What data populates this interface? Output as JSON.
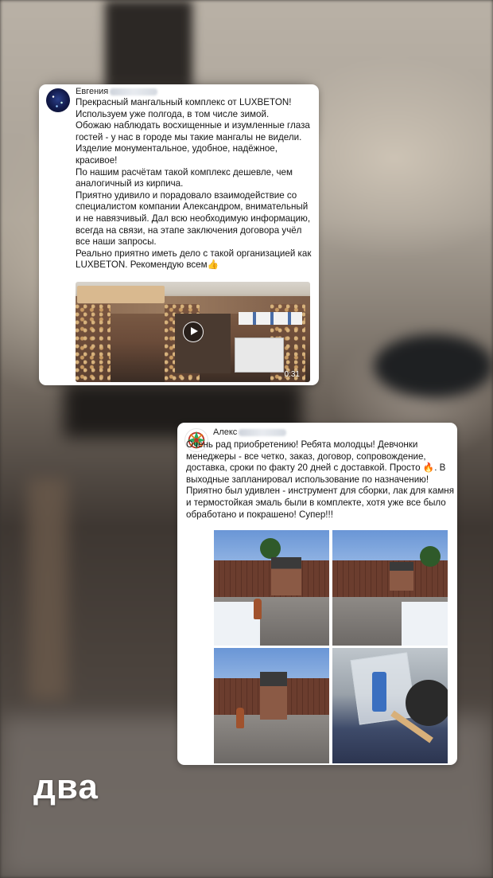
{
  "review1": {
    "author": "Евгения",
    "text": "Прекрасный мангальный комплекс от LUXBETON!\nИспользуем уже полгода, в том числе зимой.\nОбожаю наблюдать восхищенные и изумленные глаза гостей - у нас в городе мы такие мангалы не видели.\nИзделие монументальное, удобное, надёжное, красивое!\nПо нашим расчётам такой комплекс  дешевле, чем аналогичный из кирпича.\nПриятно удивило и порадовало взаимодействие со специалистом компании Александром, внимательный и не навязчивый. Дал всю необходимую информацию, всегда на связи, на этапе заключения договора учёл все наши запросы.\nРеально приятно иметь дело с такой организацией как LUXBETON. Рекомендую всем👍",
    "video": {
      "duration": "0:31",
      "icon": "play-icon"
    }
  },
  "review2": {
    "author": "Алекс",
    "text": "Очень рад приобретению! Ребята молодцы! Девчонки менеджеры - все четко, заказ, договор, сопровождение, доставка, сроки по факту 20 дней с доставкой. Просто 🔥. В выходные запланировал использование по назначению! Приятно был удивлен - инструмент для сборки, лак для камня и термостойкая эмаль были в комплекте, хотя уже все было обработано и покрашено! Супер!!!",
    "photos_count": 4
  },
  "caption": "два"
}
